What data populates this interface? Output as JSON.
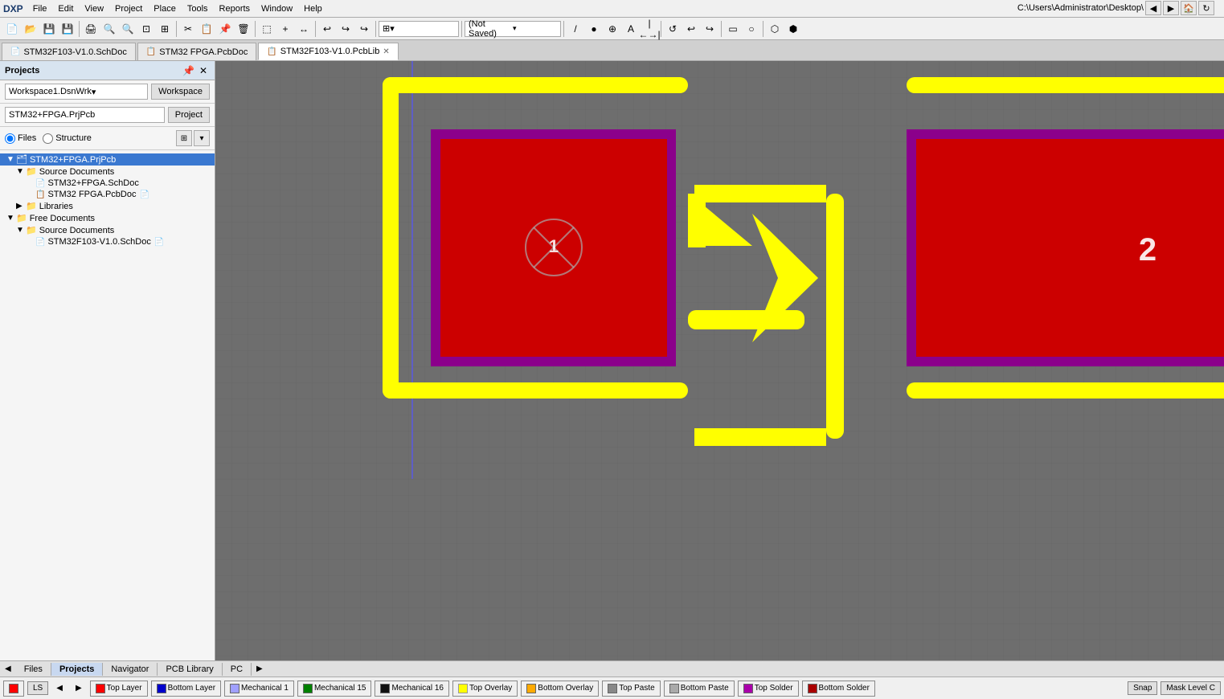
{
  "app": {
    "title": "DXP",
    "address_bar": "C:\\Users\\Administrator\\Desktop\\"
  },
  "menu": {
    "items": [
      "DXP",
      "File",
      "Edit",
      "View",
      "Project",
      "Place",
      "Tools",
      "Reports",
      "Window",
      "Help"
    ]
  },
  "toolbar": {
    "dropdown_label": "(Not Saved)"
  },
  "sidebar": {
    "title": "Projects",
    "workspace_label": "Workspace1.DsnWrk",
    "workspace_btn": "Workspace",
    "project_label": "STM32+FPGA.PrjPcb",
    "project_btn": "Project",
    "view_files": "Files",
    "view_structure": "Structure",
    "tree": [
      {
        "id": "root",
        "label": "STM32+FPGA.PrjPcb",
        "indent": 0,
        "expand": "▼",
        "icon": "🗂",
        "selected": true
      },
      {
        "id": "src1",
        "label": "Source Documents",
        "indent": 1,
        "expand": "▼",
        "icon": "📁"
      },
      {
        "id": "sch1",
        "label": "STM32+FPGA.SchDoc",
        "indent": 2,
        "expand": "",
        "icon": "📄"
      },
      {
        "id": "pcb1",
        "label": "STM32 FPGA.PcbDoc",
        "indent": 2,
        "expand": "",
        "icon": "📋"
      },
      {
        "id": "lib1",
        "label": "Libraries",
        "indent": 1,
        "expand": "▶",
        "icon": "📁"
      },
      {
        "id": "free1",
        "label": "Free Documents",
        "indent": 0,
        "expand": "▼",
        "icon": "📁"
      },
      {
        "id": "src2",
        "label": "Source Documents",
        "indent": 1,
        "expand": "▼",
        "icon": "📁"
      },
      {
        "id": "sch2",
        "label": "STM32F103-V1.0.SchDoc",
        "indent": 2,
        "expand": "",
        "icon": "📄"
      }
    ]
  },
  "tabs": [
    {
      "id": "tab1",
      "label": "STM32F103-V1.0.SchDoc",
      "icon": "📄",
      "active": false
    },
    {
      "id": "tab2",
      "label": "STM32 FPGA.PcbDoc",
      "icon": "📋",
      "active": false
    },
    {
      "id": "tab3",
      "label": "STM32F103-V1.0.PcbLib",
      "icon": "📋",
      "active": true
    }
  ],
  "bottom_tabs": [
    "Files",
    "Projects",
    "Navigator",
    "PCB Library",
    "PC"
  ],
  "active_bottom_tab": "Projects",
  "status_layers": [
    {
      "name": "Top Layer",
      "color": "#ff0000"
    },
    {
      "name": "Bottom Layer",
      "color": "#0000cc"
    },
    {
      "name": "Mechanical 1",
      "color": "#a0a0ff"
    },
    {
      "name": "Mechanical 15",
      "color": "#008000"
    },
    {
      "name": "Mechanical 16",
      "color": "#000000"
    },
    {
      "name": "Top Overlay",
      "color": "#ffff00"
    },
    {
      "name": "Bottom Overlay",
      "color": "#ffaa00"
    },
    {
      "name": "Top Paste",
      "color": "#808080"
    },
    {
      "name": "Bottom Paste",
      "color": "#808080"
    },
    {
      "name": "Top Solder",
      "color": "#aa00aa"
    },
    {
      "name": "Bottom Solder",
      "color": "#aa0000"
    }
  ],
  "snap_label": "Snap",
  "mask_label": "Mask Level C",
  "ls_label": "LS",
  "pcb": {
    "component1_label": "1",
    "component2_label": "2"
  }
}
